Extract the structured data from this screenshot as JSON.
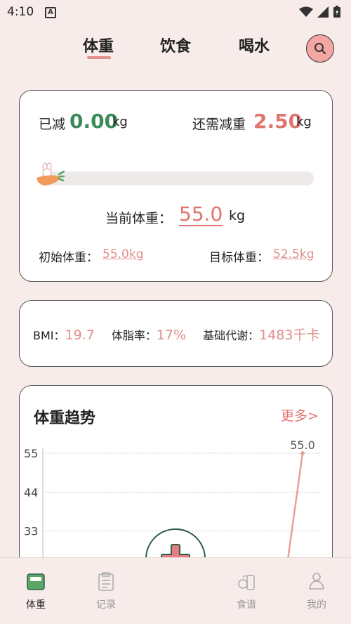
{
  "status_bar": {
    "time": "4:10",
    "notif_icon": "A"
  },
  "tabs": {
    "weight": "体重",
    "diet": "饮食",
    "water": "喝水"
  },
  "progress": {
    "lost_label": "已减",
    "lost_value": "0.00",
    "lost_unit": "kg",
    "need_label": "还需减重",
    "need_value": "2.50",
    "need_unit": "kg",
    "progress_fraction": 0,
    "current_label": "当前体重：",
    "current_value": "55.0",
    "current_unit": "kg",
    "start_label": "初始体重：",
    "start_value": "55.0kg",
    "target_label": "目标体重：",
    "target_value": "52.5kg"
  },
  "stats": {
    "bmi_label": "BMI：",
    "bmi_value": "19.7",
    "fat_label": "体脂率：",
    "fat_value": "17%",
    "bmr_label": "基础代谢：",
    "bmr_value": "1483千卡"
  },
  "trend": {
    "title": "体重趋势",
    "more": "更多>"
  },
  "chart_data": {
    "type": "line",
    "title": "体重趋势",
    "y_ticks": [
      "55",
      "44",
      "33"
    ],
    "ylim": [
      22,
      55
    ],
    "point_label": "55.0",
    "grid": true,
    "series": [
      {
        "values": [
          22,
          55.0
        ]
      }
    ]
  },
  "nav": {
    "weight": "体重",
    "record": "记录",
    "recipe": "食谱",
    "mine": "我的"
  },
  "colors": {
    "accent": "#e08f8b",
    "green": "#3a8a5a",
    "background": "#f8ecea"
  }
}
